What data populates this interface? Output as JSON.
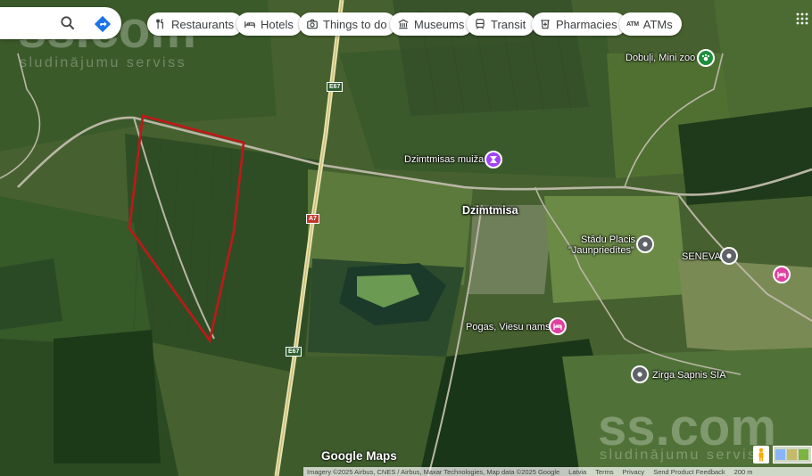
{
  "search": {
    "placeholder": ""
  },
  "chips": [
    {
      "label": "Restaurants",
      "icon": "restaurant-icon"
    },
    {
      "label": "Hotels",
      "icon": "hotel-icon"
    },
    {
      "label": "Things to do",
      "icon": "camera-icon"
    },
    {
      "label": "Museums",
      "icon": "museum-icon"
    },
    {
      "label": "Transit",
      "icon": "transit-icon"
    },
    {
      "label": "Pharmacies",
      "icon": "pharmacy-icon"
    },
    {
      "label": "ATMs",
      "icon": "atm-icon",
      "glyph": "ATM"
    }
  ],
  "places": {
    "dobuli": "Dobuļi, Mini zoo",
    "muiza": "Dzimtmisas muiža",
    "town": "Dzimtmisa",
    "stadu_line1": "Stādu Placis",
    "stadu_line2": "\"Jaunpriedītes\"",
    "seneva": "SENEVA",
    "pogas": "Pogas, Viesu nams",
    "zirga": "Zirga Sapnis SIA"
  },
  "roads": {
    "e67_top": "E67",
    "a7": "A7",
    "e67_bottom": "E67"
  },
  "watermark": {
    "logo": "ss.com",
    "tagline": "sludinājumu serviss",
    "center": "ss.com"
  },
  "footer": {
    "logo": "Google Maps",
    "imagery": "Imagery ©2025 Airbus, CNES / Airbus, Maxar Technologies, Map data ©2025 Google",
    "country": "Latvia",
    "terms": "Terms",
    "privacy": "Privacy",
    "feedback": "Send Product Feedback",
    "scale": "200 m"
  },
  "colors": {
    "plot_outline": "#c01818",
    "museum_pin": "#a142f4",
    "hotel_pin": "#e040a0",
    "zoo_pin": "#1e8e3e",
    "generic_pin": "#5f6368"
  }
}
